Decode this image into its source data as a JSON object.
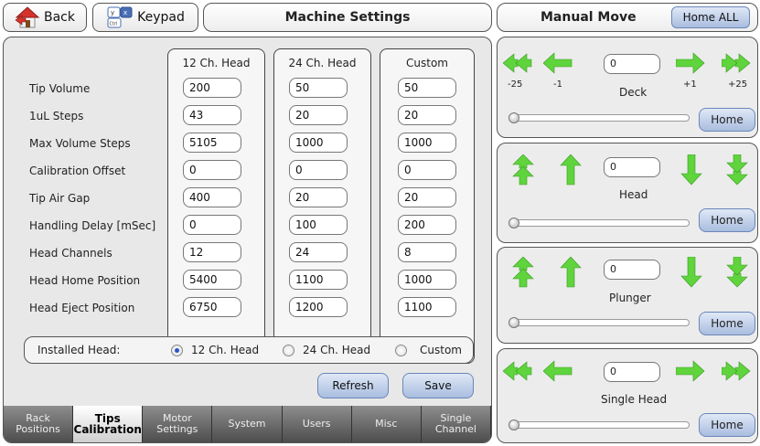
{
  "toolbar": {
    "back_label": "Back",
    "keypad_label": "Keypad",
    "title": "Machine Settings"
  },
  "columns": {
    "headers": [
      "12 Ch. Head",
      "24 Ch. Head",
      "Custom"
    ]
  },
  "rows": [
    {
      "label": "Tip Volume",
      "values": [
        "200",
        "50",
        "50"
      ]
    },
    {
      "label": "1uL Steps",
      "values": [
        "43",
        "20",
        "20"
      ]
    },
    {
      "label": "Max Volume Steps",
      "values": [
        "5105",
        "1000",
        "1000"
      ]
    },
    {
      "label": "Calibration Offset",
      "values": [
        "0",
        "0",
        "0"
      ]
    },
    {
      "label": "Tip Air Gap",
      "values": [
        "400",
        "20",
        "20"
      ]
    },
    {
      "label": "Handling Delay [mSec]",
      "values": [
        "0",
        "100",
        "200"
      ]
    },
    {
      "label": "Head Channels",
      "values": [
        "12",
        "24",
        "8"
      ]
    },
    {
      "label": "Head Home Position",
      "values": [
        "5400",
        "1100",
        "1000"
      ]
    },
    {
      "label": "Head Eject Position",
      "values": [
        "6750",
        "1200",
        "1100"
      ]
    }
  ],
  "installed_head": {
    "label": "Installed Head:",
    "options": [
      "12 Ch. Head",
      "24 Ch. Head",
      "Custom"
    ],
    "selected": "12 Ch. Head"
  },
  "actions": {
    "refresh_label": "Refresh",
    "save_label": "Save"
  },
  "tabs": [
    {
      "label": "Rack\nPositions",
      "active": false
    },
    {
      "label": "Tips\nCalibration",
      "active": true
    },
    {
      "label": "Motor\nSettings",
      "active": false
    },
    {
      "label": "System",
      "active": false
    },
    {
      "label": "Users",
      "active": false
    },
    {
      "label": "Misc",
      "active": false
    },
    {
      "label": "Single\nChannel",
      "active": false
    }
  ],
  "manual_move": {
    "title": "Manual Move",
    "home_all_label": "Home ALL",
    "deck": {
      "label": "Deck",
      "value": "0",
      "steps": [
        "-25",
        "-1",
        "+1",
        "+25"
      ],
      "home_label": "Home"
    },
    "head": {
      "label": "Head",
      "value": "0",
      "home_label": "Home"
    },
    "plunger": {
      "label": "Plunger",
      "value": "0",
      "home_label": "Home"
    },
    "single_head": {
      "label": "Single Head",
      "value": "0",
      "home_label": "Home"
    }
  },
  "colors": {
    "arrow_green": "#5fd43d",
    "accent_blue": "#a9bddf",
    "tab_bar": "#5a5a5a"
  }
}
